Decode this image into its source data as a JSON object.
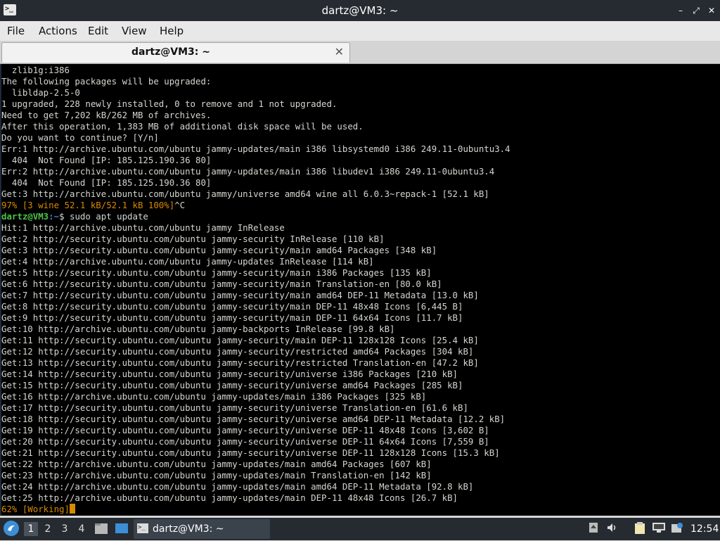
{
  "window": {
    "title": "dartz@VM3: ~",
    "icon_glyph": ">_",
    "minimize_glyph": "–",
    "maximize_glyph": "⤢",
    "close_glyph": "✕"
  },
  "menu": {
    "items": [
      "File",
      "Actions",
      "Edit",
      "View",
      "Help"
    ]
  },
  "tabs": [
    {
      "label": "dartz@VM3: ~",
      "close_glyph": "✕"
    }
  ],
  "terminal": {
    "lines": [
      {
        "type": "text",
        "text": "  zlib1g:i386"
      },
      {
        "type": "text",
        "text": "The following packages will be upgraded:"
      },
      {
        "type": "text",
        "text": "  libldap-2.5-0"
      },
      {
        "type": "text",
        "text": "1 upgraded, 228 newly installed, 0 to remove and 1 not upgraded."
      },
      {
        "type": "text",
        "text": "Need to get 7,202 kB/262 MB of archives."
      },
      {
        "type": "text",
        "text": "After this operation, 1,383 MB of additional disk space will be used."
      },
      {
        "type": "text",
        "text": "Do you want to continue? [Y/n]"
      },
      {
        "type": "text",
        "text": "Err:1 http://archive.ubuntu.com/ubuntu jammy-updates/main i386 libsystemd0 i386 249.11-0ubuntu3.4"
      },
      {
        "type": "text",
        "text": "  404  Not Found [IP: 185.125.190.36 80]"
      },
      {
        "type": "text",
        "text": "Err:2 http://archive.ubuntu.com/ubuntu jammy-updates/main i386 libudev1 i386 249.11-0ubuntu3.4"
      },
      {
        "type": "text",
        "text": "  404  Not Found [IP: 185.125.190.36 80]"
      },
      {
        "type": "text",
        "text": "Get:3 http://archive.ubuntu.com/ubuntu jammy/universe amd64 wine all 6.0.3~repack-1 [52.1 kB]"
      },
      {
        "type": "progress",
        "text": "97% [3 wine 52.1 kB/52.1 kB 100%]",
        "suffix": "^C"
      },
      {
        "type": "prompt",
        "user": "dartz@VM3",
        "path": ":~",
        "cmd": "$ sudo apt update"
      },
      {
        "type": "text",
        "text": "Hit:1 http://archive.ubuntu.com/ubuntu jammy InRelease"
      },
      {
        "type": "text",
        "text": "Get:2 http://security.ubuntu.com/ubuntu jammy-security InRelease [110 kB]"
      },
      {
        "type": "text",
        "text": "Get:3 http://security.ubuntu.com/ubuntu jammy-security/main amd64 Packages [348 kB]"
      },
      {
        "type": "text",
        "text": "Get:4 http://archive.ubuntu.com/ubuntu jammy-updates InRelease [114 kB]"
      },
      {
        "type": "text",
        "text": "Get:5 http://security.ubuntu.com/ubuntu jammy-security/main i386 Packages [135 kB]"
      },
      {
        "type": "text",
        "text": "Get:6 http://security.ubuntu.com/ubuntu jammy-security/main Translation-en [80.0 kB]"
      },
      {
        "type": "text",
        "text": "Get:7 http://security.ubuntu.com/ubuntu jammy-security/main amd64 DEP-11 Metadata [13.0 kB]"
      },
      {
        "type": "text",
        "text": "Get:8 http://security.ubuntu.com/ubuntu jammy-security/main DEP-11 48x48 Icons [6,445 B]"
      },
      {
        "type": "text",
        "text": "Get:9 http://security.ubuntu.com/ubuntu jammy-security/main DEP-11 64x64 Icons [11.7 kB]"
      },
      {
        "type": "text",
        "text": "Get:10 http://archive.ubuntu.com/ubuntu jammy-backports InRelease [99.8 kB]"
      },
      {
        "type": "text",
        "text": "Get:11 http://security.ubuntu.com/ubuntu jammy-security/main DEP-11 128x128 Icons [25.4 kB]"
      },
      {
        "type": "text",
        "text": "Get:12 http://security.ubuntu.com/ubuntu jammy-security/restricted amd64 Packages [304 kB]"
      },
      {
        "type": "text",
        "text": "Get:13 http://security.ubuntu.com/ubuntu jammy-security/restricted Translation-en [47.2 kB]"
      },
      {
        "type": "text",
        "text": "Get:14 http://security.ubuntu.com/ubuntu jammy-security/universe i386 Packages [210 kB]"
      },
      {
        "type": "text",
        "text": "Get:15 http://security.ubuntu.com/ubuntu jammy-security/universe amd64 Packages [285 kB]"
      },
      {
        "type": "text",
        "text": "Get:16 http://archive.ubuntu.com/ubuntu jammy-updates/main i386 Packages [325 kB]"
      },
      {
        "type": "text",
        "text": "Get:17 http://security.ubuntu.com/ubuntu jammy-security/universe Translation-en [61.6 kB]"
      },
      {
        "type": "text",
        "text": "Get:18 http://security.ubuntu.com/ubuntu jammy-security/universe amd64 DEP-11 Metadata [12.2 kB]"
      },
      {
        "type": "text",
        "text": "Get:19 http://security.ubuntu.com/ubuntu jammy-security/universe DEP-11 48x48 Icons [3,602 B]"
      },
      {
        "type": "text",
        "text": "Get:20 http://security.ubuntu.com/ubuntu jammy-security/universe DEP-11 64x64 Icons [7,559 B]"
      },
      {
        "type": "text",
        "text": "Get:21 http://security.ubuntu.com/ubuntu jammy-security/universe DEP-11 128x128 Icons [15.3 kB]"
      },
      {
        "type": "text",
        "text": "Get:22 http://archive.ubuntu.com/ubuntu jammy-updates/main amd64 Packages [607 kB]"
      },
      {
        "type": "text",
        "text": "Get:23 http://archive.ubuntu.com/ubuntu jammy-updates/main Translation-en [142 kB]"
      },
      {
        "type": "text",
        "text": "Get:24 http://archive.ubuntu.com/ubuntu jammy-updates/main amd64 DEP-11 Metadata [92.8 kB]"
      },
      {
        "type": "text",
        "text": "Get:25 http://archive.ubuntu.com/ubuntu jammy-updates/main DEP-11 48x48 Icons [26.7 kB]"
      },
      {
        "type": "progress_cursor",
        "text": "62% [Working]"
      }
    ]
  },
  "taskbar": {
    "workspaces": [
      "1",
      "2",
      "3",
      "4"
    ],
    "active_workspace": "1",
    "task_label": "dartz@VM3: ~",
    "clock": "12:54"
  },
  "colors": {
    "prompt_user": "#4cc24c",
    "prompt_path": "#4a7fd8",
    "progress": "#d68a00",
    "terminal_bg": "#000000",
    "terminal_fg": "#d3d7cf",
    "panel_bg": "#262b31"
  }
}
